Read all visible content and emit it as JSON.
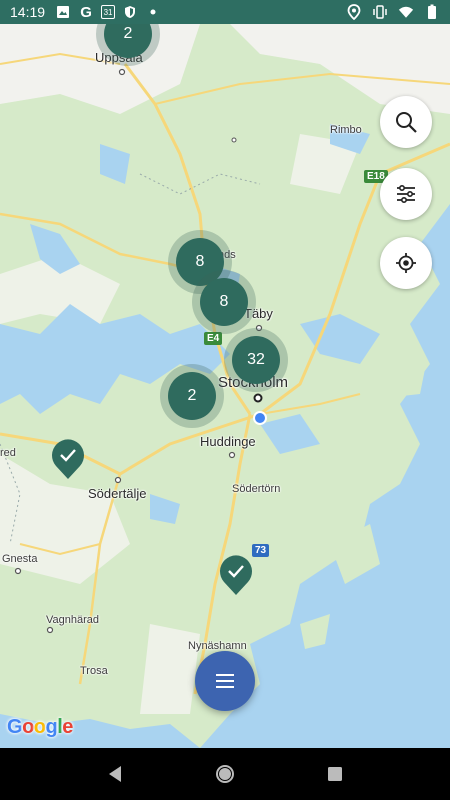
{
  "status_bar": {
    "time": "14:19",
    "left_icons": [
      "image-icon",
      "google-icon",
      "calendar-icon",
      "shield-icon",
      "dot-icon"
    ],
    "calendar_day": "31",
    "google_glyph": "G",
    "right_icons": [
      "location-icon",
      "vibrate-icon",
      "wifi-icon",
      "battery-icon"
    ]
  },
  "map": {
    "places": {
      "uppsala": "Uppsala",
      "rimbo": "Rimbo",
      "taby": "Täby",
      "stockholm": "Stockholm",
      "huddinge": "Huddinge",
      "sodertalje": "Södertälje",
      "sodertorn": "Södertörn",
      "gnesta": "Gnesta",
      "vagnharad": "Vagnhärad",
      "trosa": "Trosa",
      "nynashamn": "Nynäshamn",
      "enkoping_partial": "red",
      "sigtuna_partial": "nds"
    },
    "roads": {
      "e18": "E18",
      "e4": "E4",
      "r73": "73"
    },
    "clusters": {
      "uppsala": "2",
      "north_1": "8",
      "north_2": "8",
      "stockholm": "32",
      "west_stockholm": "2"
    },
    "google": "Google",
    "colors": {
      "land": "#d6eac9",
      "water": "#a9d3f0",
      "road": "#f6d77a",
      "cluster": "#2f6b5e",
      "fab": "#3d64b0"
    }
  },
  "controls": {
    "search": "search-icon",
    "filter": "filter-icon",
    "locate": "my-location-icon",
    "menu": "menu-icon"
  },
  "nav_bar": {
    "buttons": [
      "back-icon",
      "home-icon",
      "recents-icon"
    ]
  }
}
